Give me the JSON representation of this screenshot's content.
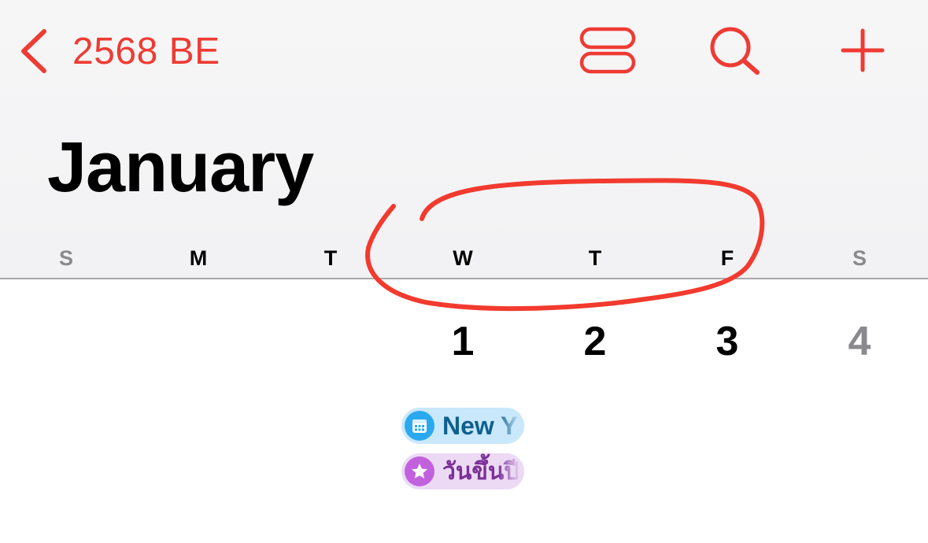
{
  "nav": {
    "back_label": "2568 BE",
    "back_icon": "chevron-left-icon",
    "list_icon": "list-view-icon",
    "search_icon": "search-icon",
    "add_icon": "plus-icon"
  },
  "calendar": {
    "month_title": "January",
    "weekdays": [
      "S",
      "M",
      "T",
      "W",
      "T",
      "F",
      "S"
    ],
    "days": [
      "1",
      "2",
      "3",
      "4"
    ],
    "events": [
      {
        "title": "New Year's Day",
        "visible_text": "New Y",
        "icon": "calendar-icon",
        "color": "#2aa9ee"
      },
      {
        "title": "วันขึ้นปีใหม่",
        "visible_text": "วันขึ้นปี",
        "icon": "star-icon",
        "color": "#c261de"
      }
    ]
  },
  "colors": {
    "accent": "#ee3b33",
    "weekend_text": "#8a8a8e",
    "annotation": "#f23a2e"
  }
}
